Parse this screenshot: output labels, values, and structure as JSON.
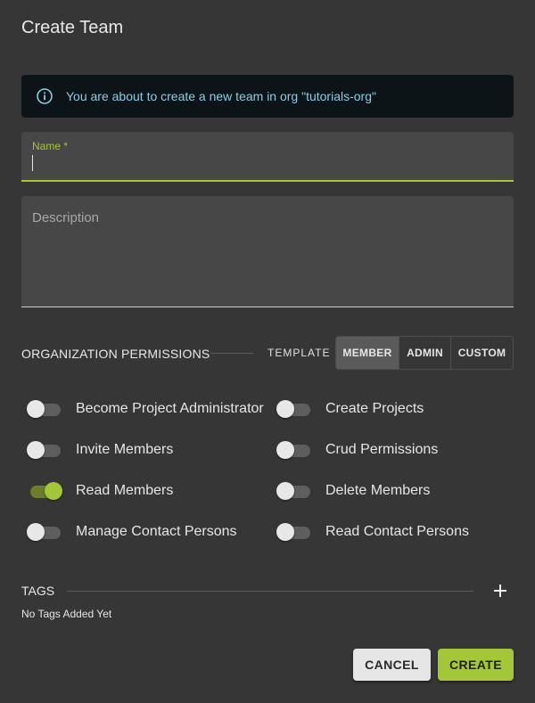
{
  "dialog": {
    "title": "Create Team",
    "info_icon": "info-circle-icon",
    "info_text": "You are about to create a new team in org \"tutorials-org\""
  },
  "form": {
    "name_label": "Name *",
    "name_value": "",
    "description_placeholder": "Description",
    "description_value": ""
  },
  "permissions": {
    "title": "ORGANIZATION PERMISSIONS",
    "template_label": "TEMPLATE",
    "templates": [
      "MEMBER",
      "ADMIN",
      "CUSTOM"
    ],
    "selected_template": "MEMBER",
    "items": [
      {
        "label": "Become Project Administrator",
        "enabled": false
      },
      {
        "label": "Create Projects",
        "enabled": false
      },
      {
        "label": "Invite Members",
        "enabled": false
      },
      {
        "label": "Crud Permissions",
        "enabled": false
      },
      {
        "label": "Read Members",
        "enabled": true
      },
      {
        "label": "Delete Members",
        "enabled": false
      },
      {
        "label": "Manage Contact Persons",
        "enabled": false
      },
      {
        "label": "Read Contact Persons",
        "enabled": false
      }
    ]
  },
  "tags": {
    "title": "TAGS",
    "add_icon": "plus-icon",
    "empty_text": "No Tags Added Yet"
  },
  "actions": {
    "cancel_label": "CANCEL",
    "create_label": "CREATE"
  },
  "colors": {
    "accent": "#a4c639",
    "info_text": "#8ecbe6",
    "background": "#363636"
  }
}
